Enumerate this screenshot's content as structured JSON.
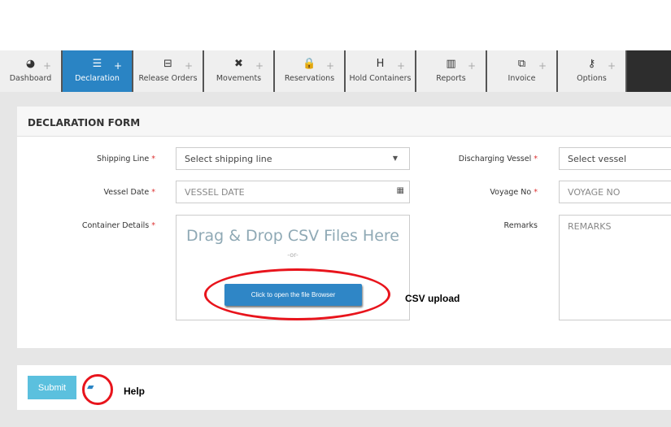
{
  "nav": {
    "tabs": [
      {
        "label": "Dashboard",
        "icon": "dashboard-icon",
        "glyph": "◕"
      },
      {
        "label": "Declaration",
        "icon": "list-icon",
        "glyph": "☰",
        "active": true
      },
      {
        "label": "Release Orders",
        "icon": "drive-icon",
        "glyph": "⊟"
      },
      {
        "label": "Movements",
        "icon": "arrows-icon",
        "glyph": "✖"
      },
      {
        "label": "Reservations",
        "icon": "lock-icon",
        "glyph": "🔒"
      },
      {
        "label": "Hold Containers",
        "icon": "h-square-icon",
        "glyph": "H"
      },
      {
        "label": "Reports",
        "icon": "bar-chart-icon",
        "glyph": "▥"
      },
      {
        "label": "Invoice",
        "icon": "copy-icon",
        "glyph": "⧉"
      },
      {
        "label": "Options",
        "icon": "key-icon",
        "glyph": "⚷"
      }
    ],
    "plus": "+"
  },
  "form": {
    "title": "DECLARATION FORM",
    "shipping_line": {
      "label": "Shipping Line",
      "value": "Select shipping line"
    },
    "vessel_date": {
      "label": "Vessel Date",
      "placeholder": "VESSEL DATE"
    },
    "container_details": {
      "label": "Container Details",
      "drop_text": "Drag & Drop CSV Files Here",
      "or": "-or-",
      "browse": "Click to open the file Browser"
    },
    "discharging_vessel": {
      "label": "Discharging Vessel",
      "value": "Select vessel"
    },
    "voyage_no": {
      "label": "Voyage No",
      "placeholder": "VOYAGE NO"
    },
    "remarks": {
      "label": "Remarks",
      "placeholder": "REMARKS"
    },
    "required": "*"
  },
  "annotations": {
    "csv": "CSV upload",
    "help": "Help"
  },
  "footer": {
    "submit": "Submit"
  },
  "colors": {
    "accent": "#2a84c4",
    "submit": "#5bc0de",
    "annotation": "#e8141c"
  }
}
